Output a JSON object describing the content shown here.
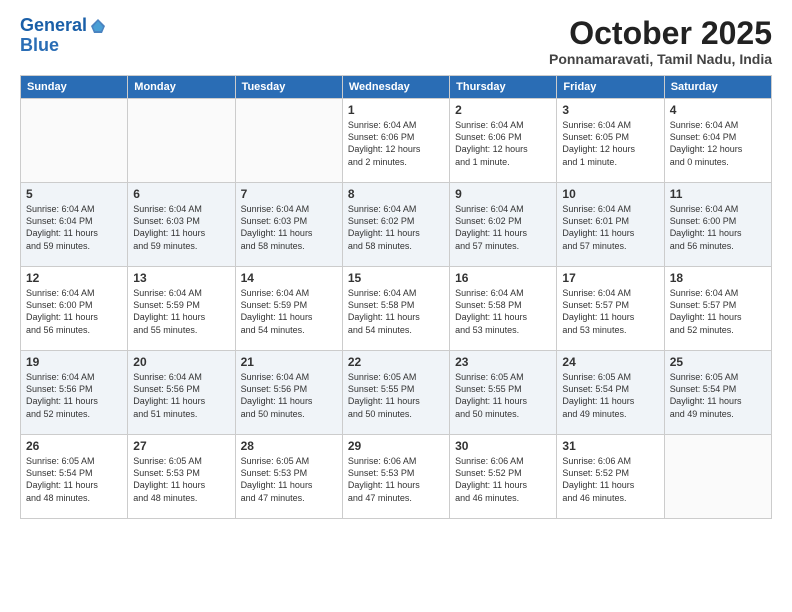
{
  "header": {
    "logo_line1": "General",
    "logo_line2": "Blue",
    "month": "October 2025",
    "location": "Ponnamaravati, Tamil Nadu, India"
  },
  "days_of_week": [
    "Sunday",
    "Monday",
    "Tuesday",
    "Wednesday",
    "Thursday",
    "Friday",
    "Saturday"
  ],
  "weeks": [
    [
      {
        "day": "",
        "text": ""
      },
      {
        "day": "",
        "text": ""
      },
      {
        "day": "",
        "text": ""
      },
      {
        "day": "1",
        "text": "Sunrise: 6:04 AM\nSunset: 6:06 PM\nDaylight: 12 hours\nand 2 minutes."
      },
      {
        "day": "2",
        "text": "Sunrise: 6:04 AM\nSunset: 6:06 PM\nDaylight: 12 hours\nand 1 minute."
      },
      {
        "day": "3",
        "text": "Sunrise: 6:04 AM\nSunset: 6:05 PM\nDaylight: 12 hours\nand 1 minute."
      },
      {
        "day": "4",
        "text": "Sunrise: 6:04 AM\nSunset: 6:04 PM\nDaylight: 12 hours\nand 0 minutes."
      }
    ],
    [
      {
        "day": "5",
        "text": "Sunrise: 6:04 AM\nSunset: 6:04 PM\nDaylight: 11 hours\nand 59 minutes."
      },
      {
        "day": "6",
        "text": "Sunrise: 6:04 AM\nSunset: 6:03 PM\nDaylight: 11 hours\nand 59 minutes."
      },
      {
        "day": "7",
        "text": "Sunrise: 6:04 AM\nSunset: 6:03 PM\nDaylight: 11 hours\nand 58 minutes."
      },
      {
        "day": "8",
        "text": "Sunrise: 6:04 AM\nSunset: 6:02 PM\nDaylight: 11 hours\nand 58 minutes."
      },
      {
        "day": "9",
        "text": "Sunrise: 6:04 AM\nSunset: 6:02 PM\nDaylight: 11 hours\nand 57 minutes."
      },
      {
        "day": "10",
        "text": "Sunrise: 6:04 AM\nSunset: 6:01 PM\nDaylight: 11 hours\nand 57 minutes."
      },
      {
        "day": "11",
        "text": "Sunrise: 6:04 AM\nSunset: 6:00 PM\nDaylight: 11 hours\nand 56 minutes."
      }
    ],
    [
      {
        "day": "12",
        "text": "Sunrise: 6:04 AM\nSunset: 6:00 PM\nDaylight: 11 hours\nand 56 minutes."
      },
      {
        "day": "13",
        "text": "Sunrise: 6:04 AM\nSunset: 5:59 PM\nDaylight: 11 hours\nand 55 minutes."
      },
      {
        "day": "14",
        "text": "Sunrise: 6:04 AM\nSunset: 5:59 PM\nDaylight: 11 hours\nand 54 minutes."
      },
      {
        "day": "15",
        "text": "Sunrise: 6:04 AM\nSunset: 5:58 PM\nDaylight: 11 hours\nand 54 minutes."
      },
      {
        "day": "16",
        "text": "Sunrise: 6:04 AM\nSunset: 5:58 PM\nDaylight: 11 hours\nand 53 minutes."
      },
      {
        "day": "17",
        "text": "Sunrise: 6:04 AM\nSunset: 5:57 PM\nDaylight: 11 hours\nand 53 minutes."
      },
      {
        "day": "18",
        "text": "Sunrise: 6:04 AM\nSunset: 5:57 PM\nDaylight: 11 hours\nand 52 minutes."
      }
    ],
    [
      {
        "day": "19",
        "text": "Sunrise: 6:04 AM\nSunset: 5:56 PM\nDaylight: 11 hours\nand 52 minutes."
      },
      {
        "day": "20",
        "text": "Sunrise: 6:04 AM\nSunset: 5:56 PM\nDaylight: 11 hours\nand 51 minutes."
      },
      {
        "day": "21",
        "text": "Sunrise: 6:04 AM\nSunset: 5:56 PM\nDaylight: 11 hours\nand 50 minutes."
      },
      {
        "day": "22",
        "text": "Sunrise: 6:05 AM\nSunset: 5:55 PM\nDaylight: 11 hours\nand 50 minutes."
      },
      {
        "day": "23",
        "text": "Sunrise: 6:05 AM\nSunset: 5:55 PM\nDaylight: 11 hours\nand 50 minutes."
      },
      {
        "day": "24",
        "text": "Sunrise: 6:05 AM\nSunset: 5:54 PM\nDaylight: 11 hours\nand 49 minutes."
      },
      {
        "day": "25",
        "text": "Sunrise: 6:05 AM\nSunset: 5:54 PM\nDaylight: 11 hours\nand 49 minutes."
      }
    ],
    [
      {
        "day": "26",
        "text": "Sunrise: 6:05 AM\nSunset: 5:54 PM\nDaylight: 11 hours\nand 48 minutes."
      },
      {
        "day": "27",
        "text": "Sunrise: 6:05 AM\nSunset: 5:53 PM\nDaylight: 11 hours\nand 48 minutes."
      },
      {
        "day": "28",
        "text": "Sunrise: 6:05 AM\nSunset: 5:53 PM\nDaylight: 11 hours\nand 47 minutes."
      },
      {
        "day": "29",
        "text": "Sunrise: 6:06 AM\nSunset: 5:53 PM\nDaylight: 11 hours\nand 47 minutes."
      },
      {
        "day": "30",
        "text": "Sunrise: 6:06 AM\nSunset: 5:52 PM\nDaylight: 11 hours\nand 46 minutes."
      },
      {
        "day": "31",
        "text": "Sunrise: 6:06 AM\nSunset: 5:52 PM\nDaylight: 11 hours\nand 46 minutes."
      },
      {
        "day": "",
        "text": ""
      }
    ]
  ]
}
